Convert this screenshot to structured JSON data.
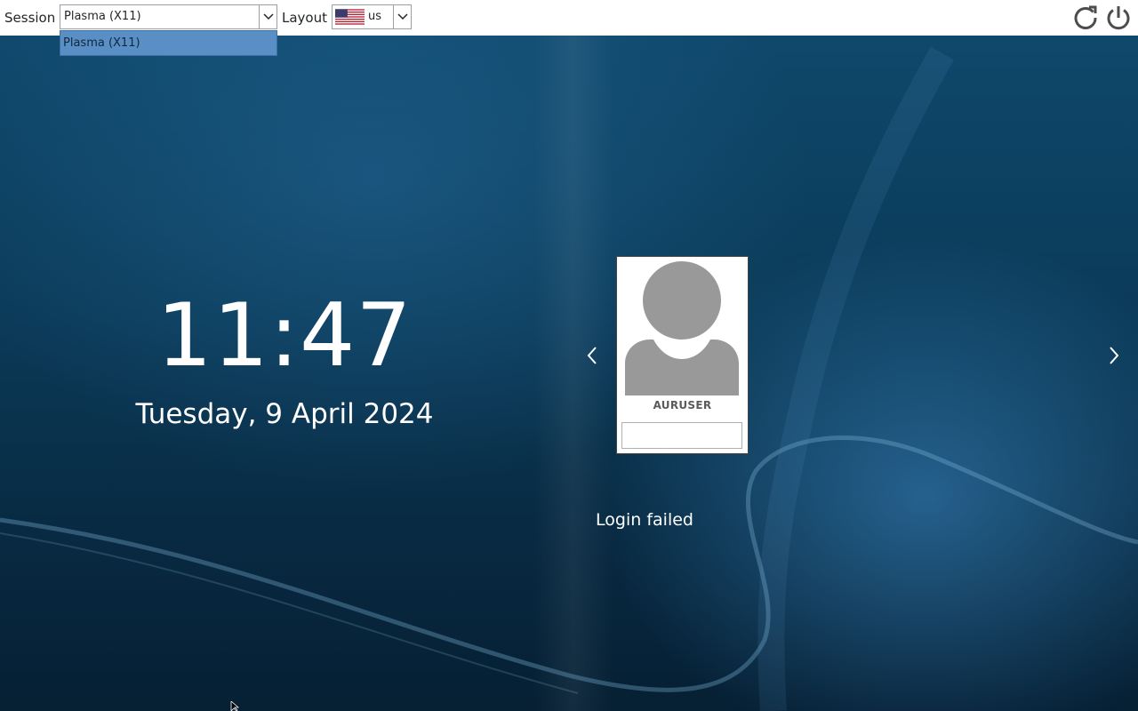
{
  "topbar": {
    "session_label": "Session",
    "session_value": "Plasma (X11)",
    "session_options": [
      "Plasma (X11)"
    ],
    "layout_label": "Layout",
    "layout_value": "us",
    "layout_flag_icon": "us-flag-icon",
    "reboot_icon": "reboot-icon",
    "shutdown_icon": "power-icon"
  },
  "clock": {
    "time": "11:47",
    "date": "Tuesday, 9 April 2024"
  },
  "login": {
    "username": "AURUSER",
    "password_value": "",
    "status": "Login failed",
    "prev_icon": "chevron-left-icon",
    "next_icon": "chevron-right-icon"
  },
  "colors": {
    "topbar_bg": "#ffffff",
    "dropdown_highlight": "#5a8fc5",
    "wallpaper_dark": "#082a42",
    "wallpaper_light": "#3c8cc8",
    "avatar_gray": "#999999"
  }
}
